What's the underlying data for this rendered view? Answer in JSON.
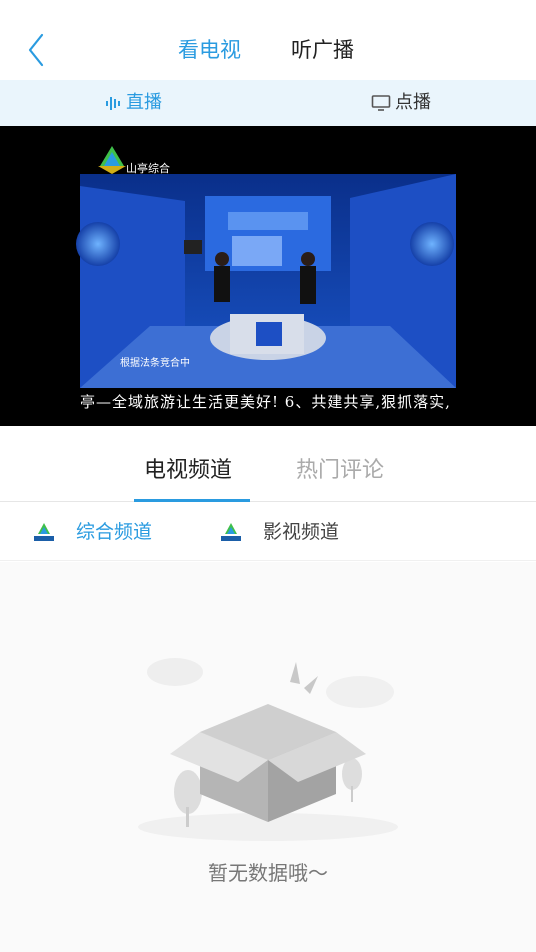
{
  "header": {
    "tabs": [
      "看电视",
      "听广播"
    ],
    "active_tab": "看电视"
  },
  "subtabs": {
    "live": "直播",
    "vod": "点播"
  },
  "video": {
    "channel_logo": "山亭综合",
    "studio_caption": "根据法条竞合中",
    "ticker": "亭—全域旅游让生活更美好! 6、共建共享,狠抓落实,"
  },
  "channel_tabs": {
    "tv_channels": "电视频道",
    "hot_comments": "热门评论"
  },
  "channels": [
    {
      "label": "综合频道",
      "icon_text": "综合频道",
      "active": true
    },
    {
      "label": "影视频道",
      "icon_text": "影视频道",
      "active": false
    }
  ],
  "empty": {
    "message": "暂无数据哦～"
  },
  "colors": {
    "accent": "#2a9be0"
  }
}
